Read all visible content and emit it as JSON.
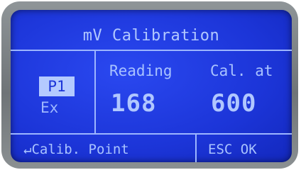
{
  "screen": {
    "title": "mV Calibration",
    "points": {
      "selected": "P1",
      "other": "Ex"
    },
    "columns": {
      "reading_label": "Reading",
      "reading_value": "168",
      "calat_label": "Cal. at",
      "calat_value": "600"
    },
    "footer": {
      "left_hint": "↵Calib. Point",
      "right_hint": "ESC OK"
    }
  },
  "colors": {
    "screen_background": "#1c35d8",
    "text": "#a9c3ff",
    "bezel": "#7a7f82"
  }
}
